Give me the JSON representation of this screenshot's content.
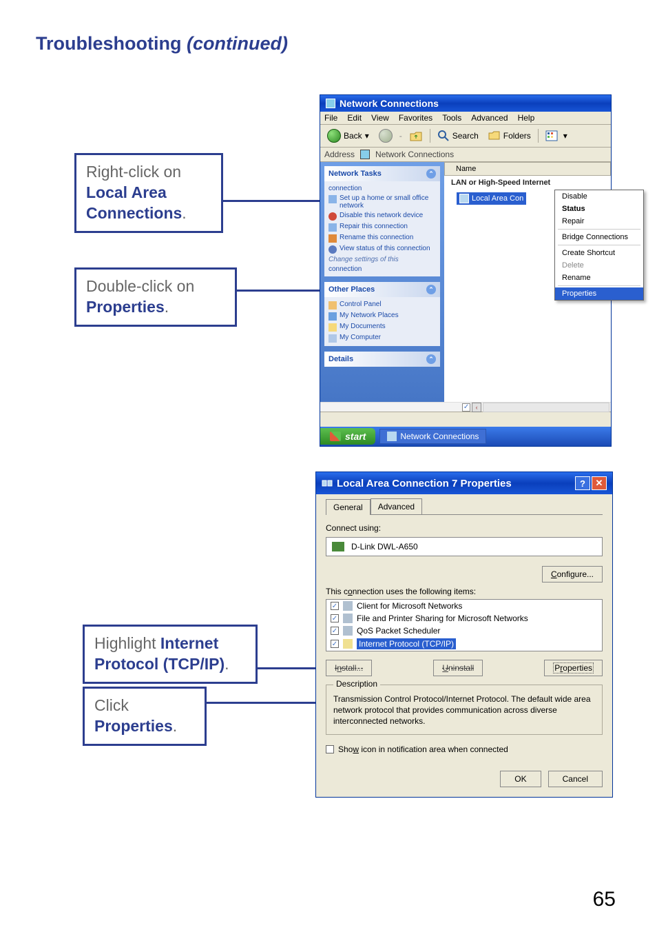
{
  "page": {
    "title_a": "Troubleshooting",
    "title_b": " (continued)",
    "number": "65"
  },
  "callouts": {
    "c1a": "Right-click on ",
    "c1b": "Local Area Connections",
    "c1c": ".",
    "c2a": "Double-click on ",
    "c2b": "Properties",
    "c2c": ".",
    "c3a": "Highlight ",
    "c3b": "Internet Protocol  (TCP/IP)",
    "c3c": ".",
    "c4a": "Click ",
    "c4b": "Properties",
    "c4c": "."
  },
  "nc": {
    "title": "Network Connections",
    "menus": [
      "File",
      "Edit",
      "View",
      "Favorites",
      "Tools",
      "Advanced",
      "Help"
    ],
    "back": "Back",
    "search": "Search",
    "folders": "Folders",
    "addr_label": "Address",
    "addr_value": "Network Connections",
    "tasks": {
      "title": "Network Tasks",
      "items": [
        "connection",
        "Set up a home or small office network",
        "Disable this network device",
        "Repair this connection",
        "Rename this connection",
        "View status of this connection",
        "connection"
      ],
      "cut": "Change settings of this"
    },
    "places": {
      "title": "Other Places",
      "items": [
        "Control Panel",
        "My Network Places",
        "My Documents",
        "My Computer"
      ]
    },
    "details": {
      "title": "Details"
    },
    "col_name": "Name",
    "group": "LAN or High-Speed Internet",
    "sel": "Local Area Con",
    "ctx": {
      "items": [
        "Disable",
        "Status",
        "Repair"
      ],
      "group2": [
        "Bridge Connections"
      ],
      "group3": [
        "Create Shortcut",
        "Delete",
        "Rename"
      ],
      "hl": "Properties"
    },
    "start": "start",
    "task_item": "Network Connections"
  },
  "dlg": {
    "title": "Local Area Connection 7 Properties",
    "tabs": [
      "General",
      "Advanced"
    ],
    "connect_using": "Connect using:",
    "adapter": "D-Link DWL-A650",
    "configure": "Configure...",
    "conn_items": "This connection uses the following items:",
    "items": [
      "Client for Microsoft Networks",
      "File and Printer Sharing for Microsoft Networks",
      "QoS Packet Scheduler",
      "Internet Protocol (TCP/IP)"
    ],
    "install": "Install...",
    "uninstall": "Uninstall",
    "properties": "Properties",
    "desc_label": "Description",
    "desc_text": "Transmission Control Protocol/Internet Protocol. The default wide area network protocol that provides communication across diverse interconnected networks.",
    "show_icon": "Show icon in notification area when connected",
    "ok": "OK",
    "cancel": "Cancel"
  }
}
